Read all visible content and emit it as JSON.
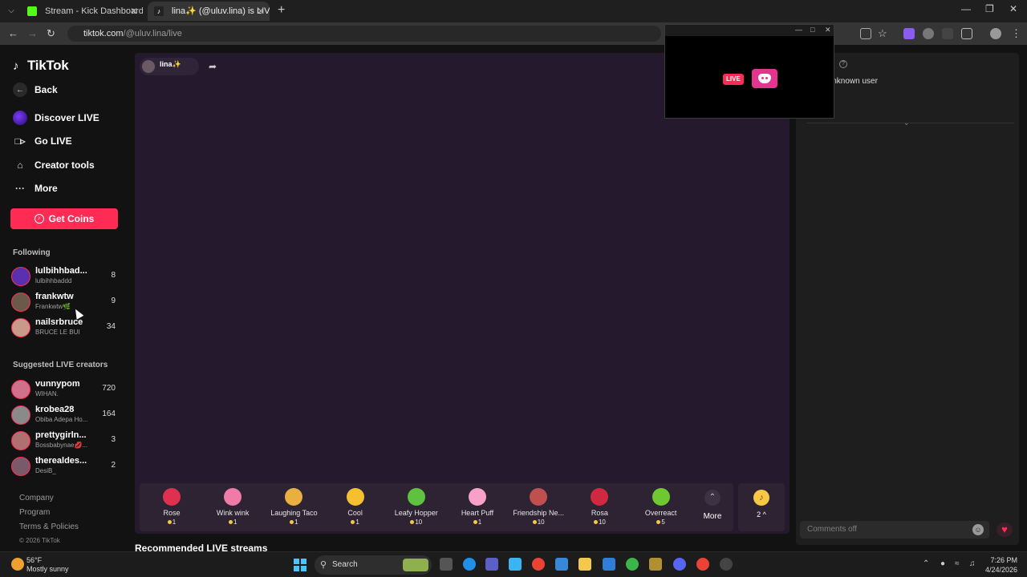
{
  "browser": {
    "tabs": [
      {
        "title": "Stream - Kick Dashboard",
        "favicon_color": "#53fc18"
      },
      {
        "title": "lina✨ (@uluv.lina) is LIVE - TikTok",
        "favicon_color": "#ffffff"
      }
    ],
    "url_host": "tiktok.com",
    "url_path": "/@uluv.lina/live"
  },
  "sidebar": {
    "logo": "TikTok",
    "back": "Back",
    "nav": [
      {
        "label": "Discover LIVE",
        "icon": "discover-live-icon"
      },
      {
        "label": "Go LIVE",
        "icon": "video-camera-icon"
      },
      {
        "label": "Creator tools",
        "icon": "house-icon"
      },
      {
        "label": "More",
        "icon": "ellipsis-icon"
      }
    ],
    "get_coins": "Get Coins",
    "following_title": "Following",
    "following": [
      {
        "name": "lulbihhbad...",
        "sub": "lulbihhbaddd",
        "count": "8",
        "color": "#5a2fb0"
      },
      {
        "name": "frankwtw",
        "sub": "Frankwtw🌿",
        "count": "9",
        "color": "#6b5a4a"
      },
      {
        "name": "nailsrbruce",
        "sub": "BRUCE LE BUI",
        "count": "34",
        "color": "#c89a8a"
      }
    ],
    "suggested_title": "Suggested LIVE creators",
    "suggested": [
      {
        "name": "vunnypom",
        "sub": "WIHAN.",
        "count": "720",
        "color": "#d0708a"
      },
      {
        "name": "krobea28",
        "sub": "Obiba Adepa Ho...",
        "count": "164",
        "color": "#8a8a8a"
      },
      {
        "name": "prettygirln...",
        "sub": "Bossbabynae💋...",
        "count": "3",
        "color": "#b07070"
      },
      {
        "name": "therealdes...",
        "sub": "DesiB_",
        "count": "2",
        "color": "#7a5a6a"
      }
    ],
    "footer": [
      "Company",
      "Program",
      "Terms & Policies"
    ],
    "copyright": "© 2026 TikTok"
  },
  "stream": {
    "host_name": "lina✨",
    "gifts": [
      {
        "name": "Rose",
        "price": "1",
        "color": "#e03050"
      },
      {
        "name": "Wink wink",
        "price": "1",
        "color": "#f07aa8"
      },
      {
        "name": "Laughing Taco",
        "price": "1",
        "color": "#e8b040"
      },
      {
        "name": "Cool",
        "price": "1",
        "color": "#f5c030"
      },
      {
        "name": "Leafy Hopper",
        "price": "10",
        "color": "#60c040"
      },
      {
        "name": "Heart Puff",
        "price": "1",
        "color": "#f8a0c8"
      },
      {
        "name": "Friendship Ne...",
        "price": "10",
        "color": "#c05050"
      },
      {
        "name": "Rosa",
        "price": "10",
        "color": "#d02840"
      },
      {
        "name": "Overreact",
        "price": "5",
        "color": "#70c830"
      }
    ],
    "more_label": "More",
    "coin_value": "2 ^",
    "recommended_title": "Recommended LIVE streams"
  },
  "chat": {
    "ranking_user": "Unknown user",
    "ranking_line2": "y",
    "comment_placeholder": "Comments off"
  },
  "popup": {
    "live_badge": "LIVE"
  },
  "taskbar": {
    "temp": "56°F",
    "weather": "Mostly sunny",
    "search": "Search",
    "time": "7:26 PM",
    "date": "4/24/2026"
  }
}
